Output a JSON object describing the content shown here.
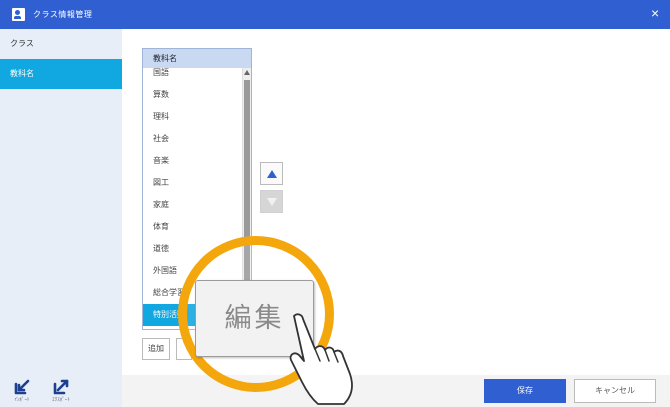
{
  "window": {
    "title": "クラス情報管理",
    "close_glyph": "×"
  },
  "sidebar": {
    "items": [
      {
        "label": "クラス",
        "active": false
      },
      {
        "label": "教科名",
        "active": true
      }
    ],
    "import_caption": "ｲﾝﾎﾟｰﾄ",
    "export_caption": "ｴｸｽﾎﾟｰﾄ"
  },
  "subject_list": {
    "header": "教科名",
    "items": [
      "国語",
      "算数",
      "理科",
      "社会",
      "音楽",
      "図工",
      "家庭",
      "体育",
      "道徳",
      "外国語",
      "総合学習",
      "特別活動"
    ],
    "selected_index": 11
  },
  "buttons": {
    "add": "追加",
    "edit_zoom": "編集",
    "save": "保存",
    "cancel": "キャンセル"
  },
  "icons": {
    "close": "close-icon",
    "app": "person-card-icon",
    "move_up": "triangle-up-icon",
    "move_down": "triangle-down-icon",
    "import": "import-arrow-icon",
    "export": "export-arrow-icon",
    "pointer": "pointing-hand-icon"
  },
  "colors": {
    "titlebar": "#2f5fd0",
    "selection": "#11a7e0",
    "sidebar": "#e8eef8",
    "highlight_ring": "#f4a70d"
  }
}
